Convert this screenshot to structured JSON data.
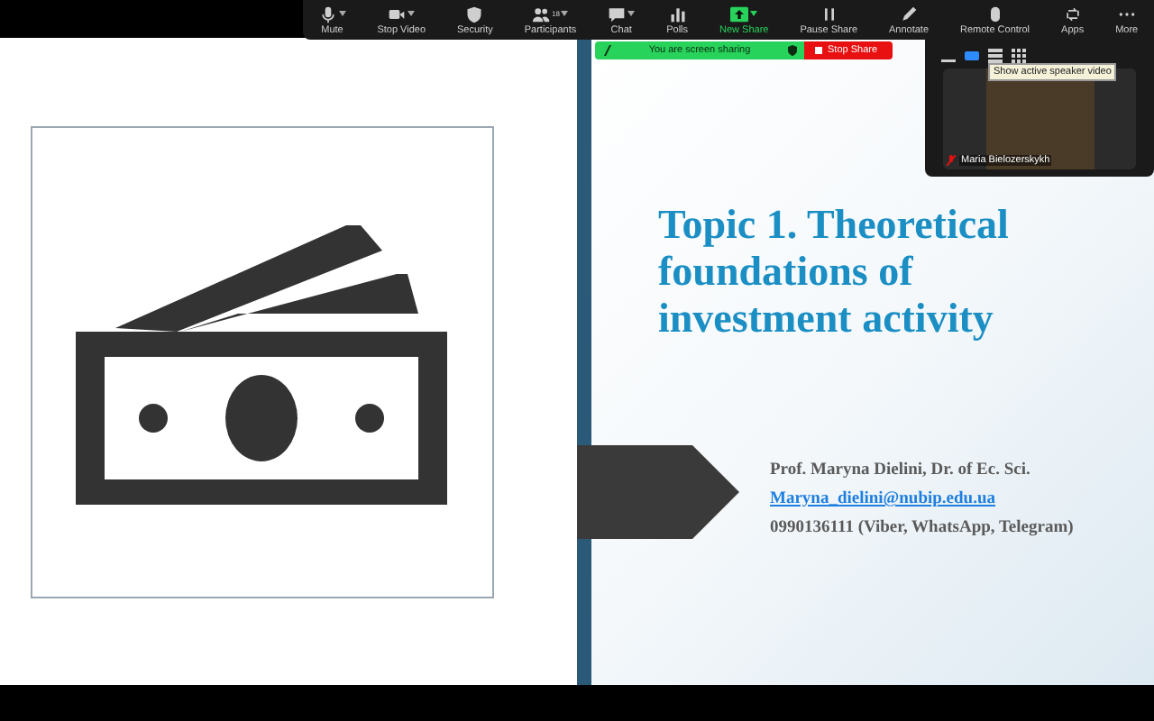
{
  "toolbar": {
    "items": [
      {
        "label": "Mute",
        "kind": "mic",
        "caret": true,
        "highlighted": false
      },
      {
        "label": "Stop Video",
        "kind": "camera",
        "caret": true,
        "highlighted": false
      },
      {
        "label": "Security",
        "kind": "shield",
        "caret": false,
        "highlighted": false
      },
      {
        "label": "Participants",
        "kind": "people",
        "count": "18",
        "caret": true,
        "highlighted": false
      },
      {
        "label": "Chat",
        "kind": "chat",
        "caret": true,
        "highlighted": false
      },
      {
        "label": "Polls",
        "kind": "polls",
        "caret": false,
        "highlighted": false
      },
      {
        "label": "New Share",
        "kind": "share",
        "caret": true,
        "highlighted": true
      },
      {
        "label": "Pause Share",
        "kind": "pause",
        "caret": false,
        "highlighted": false
      },
      {
        "label": "Annotate",
        "kind": "pen",
        "caret": false,
        "highlighted": false
      },
      {
        "label": "Remote Control",
        "kind": "mouse",
        "caret": false,
        "highlighted": false
      },
      {
        "label": "Apps",
        "kind": "apps",
        "caret": false,
        "highlighted": false
      },
      {
        "label": "More",
        "kind": "more",
        "caret": false,
        "highlighted": false
      }
    ]
  },
  "share_banner": {
    "status": "You are screen sharing",
    "stop_button": "Stop Share"
  },
  "video_panel": {
    "views": [
      {
        "kind": "minimize",
        "selected": false
      },
      {
        "kind": "speaker",
        "selected": true
      },
      {
        "kind": "strip",
        "selected": false
      },
      {
        "kind": "gallery",
        "selected": false
      }
    ],
    "tooltip": "Show active speaker video",
    "participant": {
      "name": "Maria Bielozerskykh",
      "muted": true
    }
  },
  "slide": {
    "title": "Topic 1. Theoretical foundations of investment activity",
    "author": "Prof. Maryna Dielini, Dr. of Ec. Sci.",
    "email": "Maryna_dielini@nubip.edu.ua",
    "phone": "0990136111 (Viber, WhatsApp, Telegram)"
  }
}
